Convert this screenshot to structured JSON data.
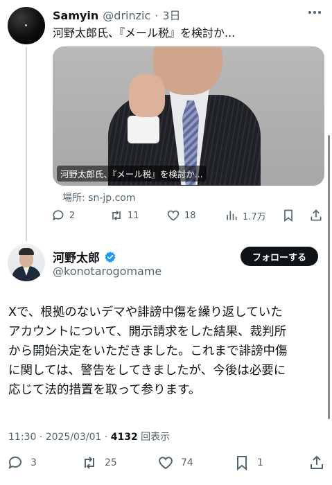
{
  "parent_tweet": {
    "name": "Samyin",
    "handle": "@drinzic",
    "separator": "·",
    "time": "3日",
    "text": "河野太郎氏、『メール税』を検討か...",
    "card_caption": "河野太郎氏、『メール税』を検討か...",
    "source": "場所: sn-jp.com",
    "actions": {
      "replies": "2",
      "reposts": "11",
      "likes": "18",
      "views": "1.7万"
    }
  },
  "main_tweet": {
    "name": "河野太郎",
    "handle": "@konotarogomame",
    "follow_label": "フォローする",
    "text_lines": [
      "Xで、根拠のないデマや誹謗中傷を繰り返していた",
      "アカウントについて、開示請求をした結果、裁判所",
      "から開始決定をいただきました。これまで誹謗中傷",
      "に関しては、警告をしてきましたが、今後は必要に",
      "応じて法的措置を取って参ります。"
    ],
    "timestamp": "11:30 · 2025/03/01 · ",
    "view_count": "4132",
    "view_suffix": " 回表示",
    "actions": {
      "replies": "3",
      "reposts": "25",
      "likes": "74",
      "bookmarks": "1"
    }
  },
  "colors": {
    "text": "#0f1419",
    "muted": "#536471",
    "verified": "#1d9bf0",
    "button": "#0f1419",
    "thread_line": "#cfd9de"
  }
}
